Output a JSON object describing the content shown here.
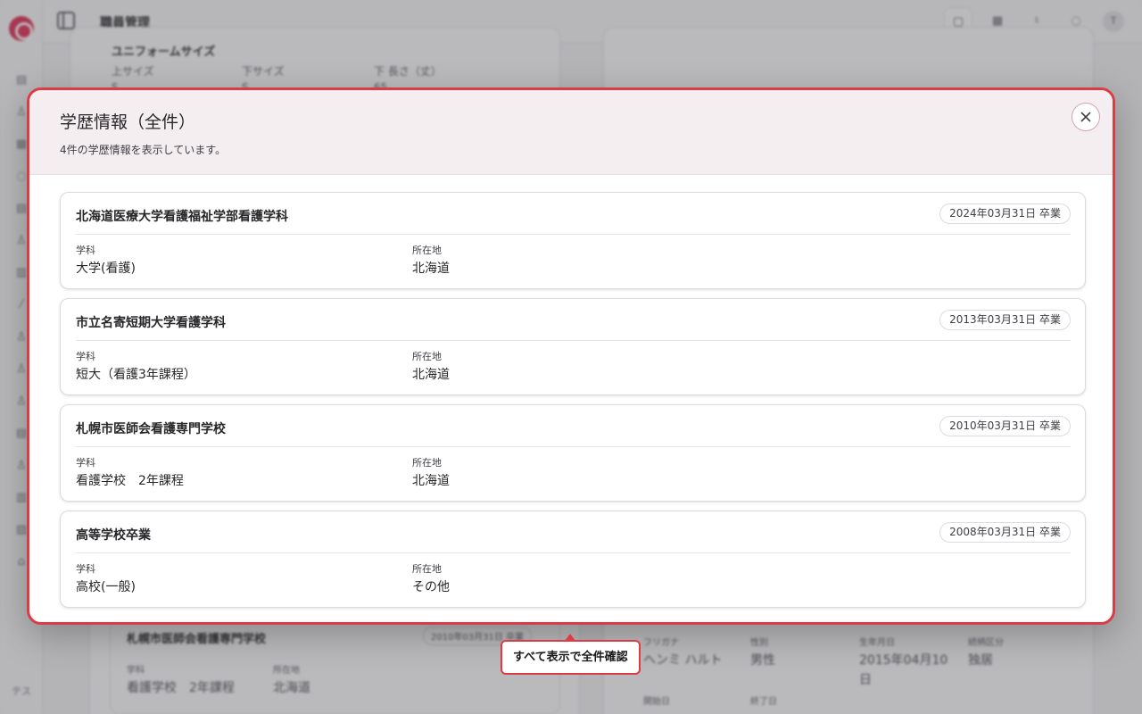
{
  "app": {
    "title": "職員管理",
    "user_initials": "テス",
    "avatar": "T"
  },
  "background": {
    "uniform": {
      "heading": "ユニフォームサイズ",
      "top_label": "上サイズ",
      "bottom_label": "下サイズ",
      "length_label": "下 長さ（丈）",
      "top_value": "S",
      "bottom_value": "S",
      "length_value": "65"
    },
    "edu_card": {
      "name": "札幌市医師会看護専門学校",
      "date": "2010年03月31日 卒業",
      "dept_label": "学科",
      "dept_value": "看護学校　2年課程",
      "location_label": "所在地",
      "location_value": "北海道"
    },
    "family": {
      "kana_label": "フリガナ",
      "kana_value": "ヘンミ ハルト",
      "gender_label": "性別",
      "gender_value": "男性",
      "birth_label": "生年月日",
      "birth_value_1": "2015年04月10",
      "birth_value_2": "日",
      "relation_label": "続柄区分",
      "relation_value": "独居",
      "start_label": "開始日",
      "end_label": "終了日"
    }
  },
  "modal": {
    "title": "学歴情報（全件）",
    "description": "4件の学歴情報を表示しています。",
    "close_label": "閉じる",
    "records": [
      {
        "name": "北海道医療大学看護福祉学部看護学科",
        "date": "2024年03月31日 卒業",
        "dept_label": "学科",
        "dept_value": "大学(看護)",
        "location_label": "所在地",
        "location_value": "北海道"
      },
      {
        "name": "市立名寄短期大学看護学科",
        "date": "2013年03月31日 卒業",
        "dept_label": "学科",
        "dept_value": "短大（看護3年課程）",
        "location_label": "所在地",
        "location_value": "北海道"
      },
      {
        "name": "札幌市医師会看護専門学校",
        "date": "2010年03月31日 卒業",
        "dept_label": "学科",
        "dept_value": "看護学校　2年課程",
        "location_label": "所在地",
        "location_value": "北海道"
      },
      {
        "name": "高等学校卒業",
        "date": "2008年03月31日 卒業",
        "dept_label": "学科",
        "dept_value": "高校(一般)",
        "location_label": "所在地",
        "location_value": "その他"
      }
    ]
  },
  "tooltip": {
    "text": "すべて表示で全件確認"
  },
  "colors": {
    "accent": "#dc3c45",
    "header_bg": "#f5eef0",
    "logo": "#e11d48"
  }
}
